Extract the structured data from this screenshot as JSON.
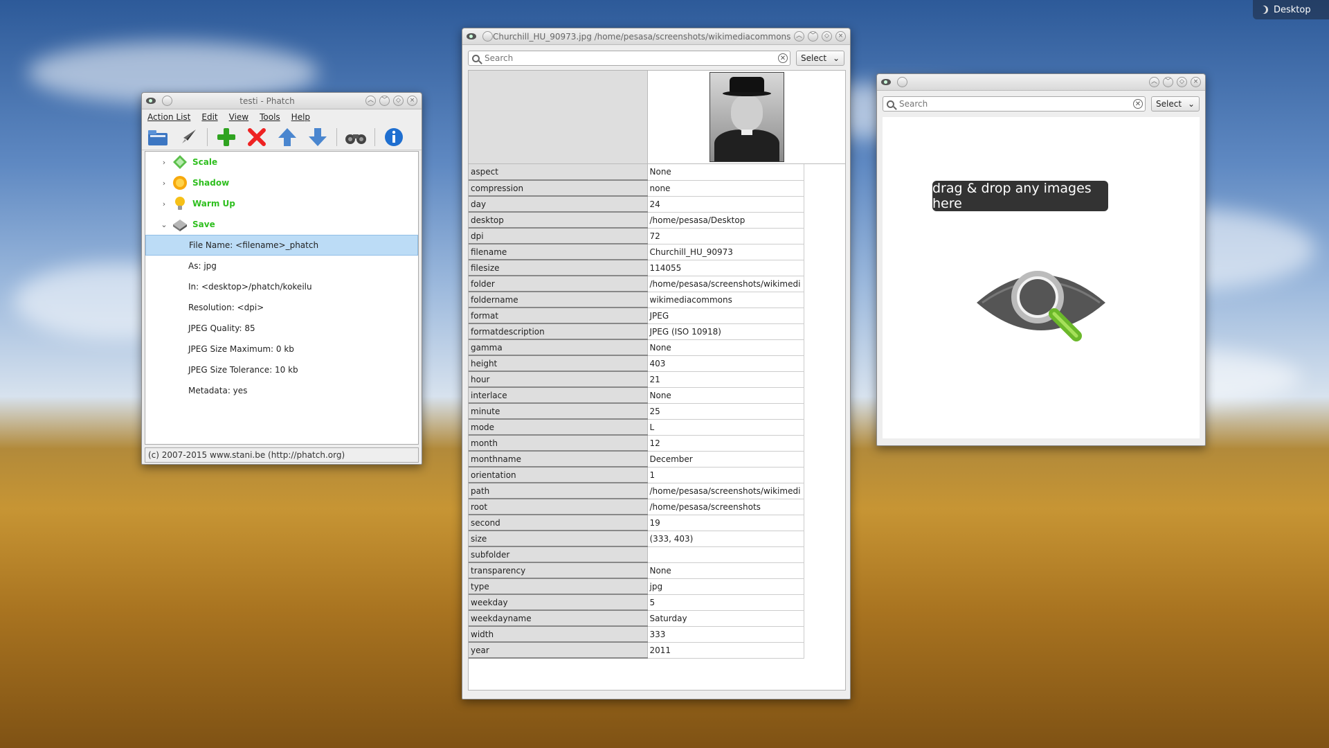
{
  "desktop": {
    "label": "Desktop"
  },
  "phatch": {
    "title": "testi - Phatch",
    "menu": [
      "Action List",
      "Edit",
      "View",
      "Tools",
      "Help"
    ],
    "actions": [
      {
        "name": "Scale",
        "icon": "scale-icon",
        "expanded": false
      },
      {
        "name": "Shadow",
        "icon": "sun-icon",
        "expanded": false
      },
      {
        "name": "Warm Up",
        "icon": "bulb-icon",
        "expanded": false
      },
      {
        "name": "Save",
        "icon": "disk-icon",
        "expanded": true
      }
    ],
    "save_options": [
      "File Name: <filename>_phatch",
      "As: jpg",
      "In: <desktop>/phatch/kokeilu",
      "Resolution: <dpi>",
      "JPEG Quality: 85",
      "JPEG Size Maximum: 0  kb",
      "JPEG Size Tolerance: 10  kb",
      "Metadata: yes"
    ],
    "status": "(c) 2007-2015 www.stani.be (http://phatch.org)"
  },
  "inspector": {
    "title": "Churchill_HU_90973.jpg /home/pesasa/screenshots/wikimediacommons",
    "search_placeholder": "Search",
    "select_label": "Select",
    "rows": [
      [
        "aspect",
        "None"
      ],
      [
        "compression",
        "none"
      ],
      [
        "day",
        "24"
      ],
      [
        "desktop",
        "/home/pesasa/Desktop"
      ],
      [
        "dpi",
        "72"
      ],
      [
        "filename",
        "Churchill_HU_90973"
      ],
      [
        "filesize",
        "114055"
      ],
      [
        "folder",
        "/home/pesasa/screenshots/wikimedi"
      ],
      [
        "foldername",
        "wikimediacommons"
      ],
      [
        "format",
        "JPEG"
      ],
      [
        "formatdescription",
        "JPEG (ISO 10918)"
      ],
      [
        "gamma",
        "None"
      ],
      [
        "height",
        "403"
      ],
      [
        "hour",
        "21"
      ],
      [
        "interlace",
        "None"
      ],
      [
        "minute",
        "25"
      ],
      [
        "mode",
        "L"
      ],
      [
        "month",
        "12"
      ],
      [
        "monthname",
        "December"
      ],
      [
        "orientation",
        "1"
      ],
      [
        "path",
        "/home/pesasa/screenshots/wikimedi"
      ],
      [
        "root",
        "/home/pesasa/screenshots"
      ],
      [
        "second",
        "19"
      ],
      [
        "size",
        "(333, 403)"
      ],
      [
        "subfolder",
        ""
      ],
      [
        "transparency",
        "None"
      ],
      [
        "type",
        "jpg"
      ],
      [
        "weekday",
        "5"
      ],
      [
        "weekdayname",
        "Saturday"
      ],
      [
        "width",
        "333"
      ],
      [
        "year",
        "2011"
      ]
    ]
  },
  "dropwin": {
    "search_placeholder": "Search",
    "select_label": "Select",
    "tip": "drag & drop any images here"
  }
}
